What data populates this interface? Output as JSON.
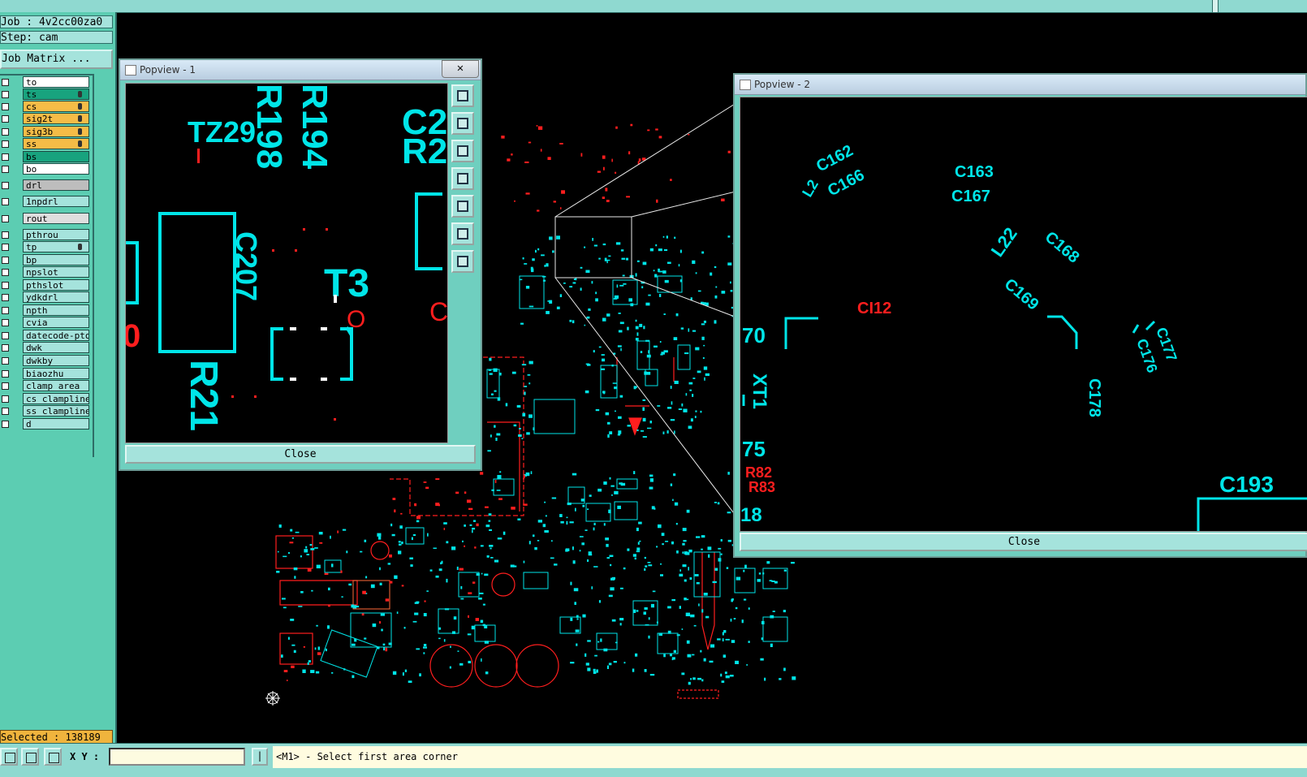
{
  "left_panel": {
    "job": "Job : 4v2cc00za0",
    "step": "Step: cam",
    "job_matrix": "Job Matrix ...",
    "layers": [
      {
        "name": "to",
        "style": "white"
      },
      {
        "name": "ts",
        "style": "green"
      },
      {
        "name": "cs",
        "style": "yellow"
      },
      {
        "name": "sig2t",
        "style": "yellow"
      },
      {
        "name": "sig3b",
        "style": "yellow"
      },
      {
        "name": "ss",
        "style": "yellow"
      },
      {
        "name": "bs",
        "style": "green"
      },
      {
        "name": "bo",
        "style": "white"
      },
      {
        "name": "drl",
        "style": "grey"
      },
      {
        "name": "1npdrl",
        "style": "teal"
      },
      {
        "name": "rout",
        "style": "lgrey"
      },
      {
        "name": "pthrou",
        "style": "teal"
      },
      {
        "name": "tp",
        "style": "teal"
      },
      {
        "name": "bp",
        "style": "teal"
      },
      {
        "name": "npslot",
        "style": "teal"
      },
      {
        "name": "pthslot",
        "style": "teal"
      },
      {
        "name": "ydkdrl",
        "style": "teal"
      },
      {
        "name": "npth",
        "style": "teal"
      },
      {
        "name": "cvia",
        "style": "teal"
      },
      {
        "name": "datecode-pto",
        "style": "teal"
      },
      {
        "name": "dwk",
        "style": "teal"
      },
      {
        "name": "dwkby",
        "style": "teal"
      },
      {
        "name": "biaozhu",
        "style": "teal"
      },
      {
        "name": "clamp_area",
        "style": "teal"
      },
      {
        "name": "cs_clamplines",
        "style": "teal"
      },
      {
        "name": "ss_clamplines",
        "style": "teal"
      },
      {
        "name": "d",
        "style": "teal"
      }
    ],
    "selected": "Selected : 138189"
  },
  "popview1": {
    "title": "Popview - 1",
    "close_x": "✕",
    "close_label": "Close",
    "labels": {
      "tz29": "TZ29",
      "r194": "R194",
      "r198": "R198",
      "c2": "C2",
      "r2": "R2",
      "c207": "C207",
      "t3": "T3",
      "r21": "R21",
      "o": "O",
      "c_part": "C",
      "zero": "0"
    }
  },
  "popview2": {
    "title": "Popview - 2",
    "close_label": "Close",
    "labels": {
      "c162": "C162",
      "c166": "C166",
      "l2": "L2",
      "c163": "C163",
      "c167": "C167",
      "l22": "L22",
      "c168": "C168",
      "c169": "C169",
      "c112": "CI12",
      "n70": "70",
      "xt1": "XT1",
      "n75": "75",
      "r82": "R82",
      "r83": "R83",
      "n18": "18",
      "c177": "C177",
      "c176": "C176",
      "c178": "C178",
      "c193": "C193"
    }
  },
  "bottom_bar": {
    "xy_label": "X Y :",
    "xy_value": "",
    "bar_btn": "|",
    "status": "<M1> - Select first area corner"
  },
  "colors": {
    "panel_bg": "#5ccdb2",
    "canvas_bg": "#000000",
    "feature_cyan": "#00e5e8",
    "feature_red": "#ff1e1e",
    "layer_green": "#18a37e",
    "layer_yellow": "#f5bc47",
    "status_bg": "#fffce0"
  },
  "icons": [
    "pan-icon",
    "zoom-icon",
    "grid-icon",
    "move-icon",
    "zoom-home-icon",
    "zoom-in-icon",
    "zoom-out-icon",
    "fit-icon",
    "crosshair-icon"
  ]
}
